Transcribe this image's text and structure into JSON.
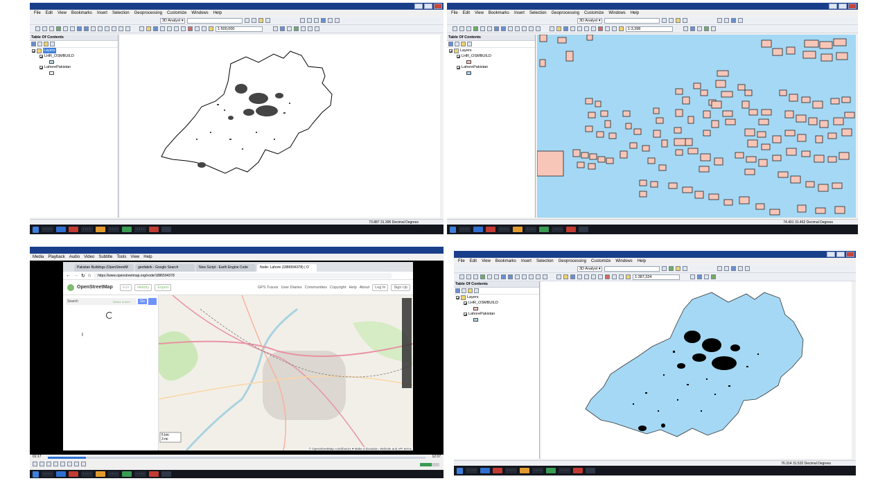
{
  "arcmap": {
    "menu": [
      "File",
      "Edit",
      "View",
      "Bookmarks",
      "Insert",
      "Selection",
      "Geoprocessing",
      "Customize",
      "Windows",
      "Help"
    ],
    "analyst_label": "3D Analyst ▾",
    "toc_title": "Table Of Contents",
    "layers_group": "Layers",
    "layer1": "LHR_OSMBUILD",
    "layer2": "LahorePakistan",
    "building_fill": "#f7c6b9",
    "boundary_fill": "#a4d8f4"
  },
  "q1": {
    "scale": "1:500,000",
    "status": "73.887  31.395 Decimal Degrees"
  },
  "q2": {
    "scale": "1:3,398",
    "status": "74.401  31.462 Decimal Degrees"
  },
  "q4": {
    "scale": "1:387,324",
    "status": "76.314  31.532 Decimal Degrees"
  },
  "vlc": {
    "menu": [
      "Media",
      "Playback",
      "Audio",
      "Video",
      "Subtitle",
      "Tools",
      "View",
      "Help"
    ],
    "time_elapsed": "01:17",
    "time_total": "12:37",
    "progress": 0.1
  },
  "browser": {
    "tabs": [
      "Pakistan Buildings (OpenStreetM",
      "geofabrik - Google Search",
      "New Script - Earth Engine Code",
      "Node: Lahore (1886594378) | O"
    ],
    "url": "https://www.openstreetmap.org/node/1886594378",
    "osm_logo": "OpenStreetMap",
    "edit": "Edit",
    "history": "History",
    "export": "Export",
    "links": [
      "GPS Traces",
      "User Diaries",
      "Communities",
      "Copyright",
      "Help",
      "About"
    ],
    "login": "Log In",
    "signup": "Sign Up",
    "search_placeholder": "Search",
    "where_is_this": "Where is this?",
    "go": "Go",
    "scale_km": "5 km",
    "scale_mi": "3 mi",
    "attribution": "© OpenStreetMap contributors ♥ Make a Donation. Website and API terms"
  }
}
